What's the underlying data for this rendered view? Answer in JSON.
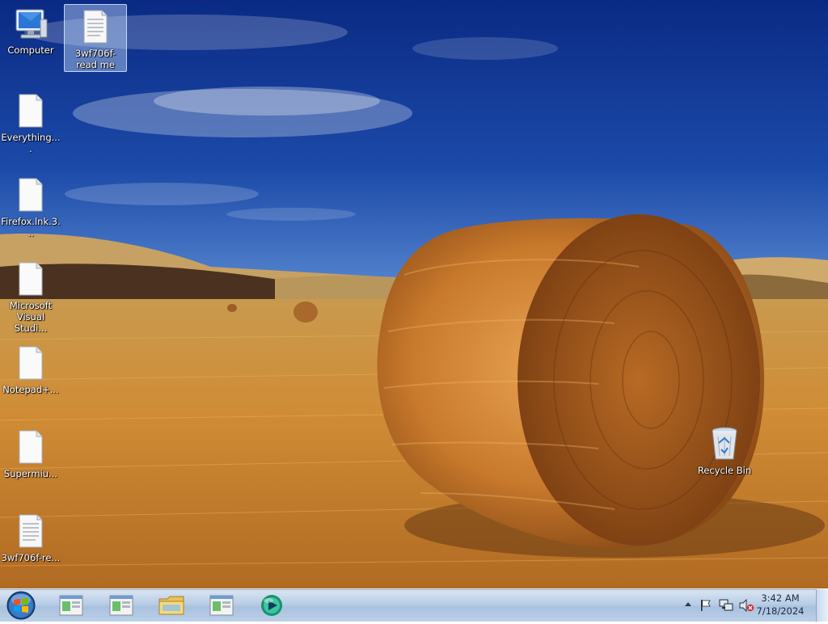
{
  "desktop": {
    "icons": [
      {
        "label": "Computer",
        "icon": "computer-icon"
      },
      {
        "label": "3wf706f-read me",
        "icon": "text-document-icon",
        "selected": true
      },
      {
        "label": "Everything....",
        "icon": "blank-file-icon"
      },
      {
        "label": "Firefox.lnk.3...",
        "icon": "blank-file-icon"
      },
      {
        "label": "Microsoft Visual Studi...",
        "icon": "blank-file-icon"
      },
      {
        "label": "Notepad+...",
        "icon": "blank-file-icon"
      },
      {
        "label": "Supermiu...",
        "icon": "blank-file-icon"
      },
      {
        "label": "3wf706f-re...",
        "icon": "text-document-icon"
      },
      {
        "label": "Recycle Bin",
        "icon": "recycle-bin-icon"
      }
    ]
  },
  "taskbar": {
    "start_icon": "windows-start-orb-icon",
    "pinned": [
      {
        "icon": "app-window-icon"
      },
      {
        "icon": "app-window-icon"
      },
      {
        "icon": "folder-icon"
      },
      {
        "icon": "app-window-icon"
      },
      {
        "icon": "media-player-icon"
      }
    ],
    "tray": {
      "icons": [
        "show-hidden-icons-arrow-icon",
        "action-center-flag-icon",
        "network-icon",
        "volume-muted-icon"
      ]
    },
    "clock": {
      "time": "3:42 AM",
      "date": "7/18/2024"
    }
  },
  "colors": {
    "sky_top": "#0c2c86",
    "field": "#c98a34",
    "taskbar": "#b9cde6"
  }
}
